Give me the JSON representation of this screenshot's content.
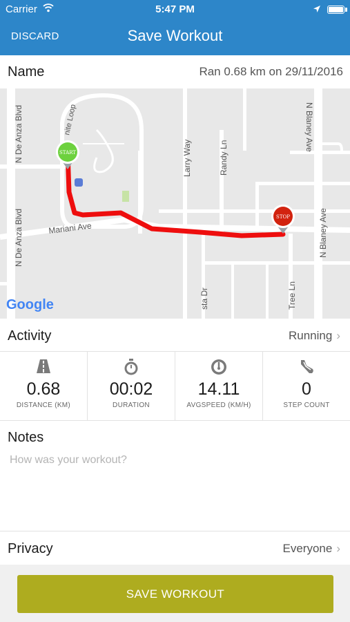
{
  "status_bar": {
    "carrier": "Carrier",
    "time": "5:47 PM"
  },
  "header": {
    "discard_label": "DISCARD",
    "title": "Save Workout",
    "background_color": "#2d86c9"
  },
  "name": {
    "label": "Name",
    "value": "Ran 0.68 km on 29/11/2016"
  },
  "map": {
    "street_labels": [
      "N De Anza Blvd",
      "N De Anza Blvd",
      "nite Loop",
      "Mariani Ave",
      "Larry Way",
      "Randy Ln",
      "N Blaney Ave",
      "N Blaney Ave",
      "sta Dr",
      "Tree Ln"
    ],
    "start_marker": "START",
    "stop_marker": "STOP",
    "logo": "Google",
    "route_color": "#ee0e0e"
  },
  "activity": {
    "label": "Activity",
    "value": "Running"
  },
  "stats": [
    {
      "icon": "road-icon",
      "value": "0.68",
      "label": "DISTANCE (KM)"
    },
    {
      "icon": "stopwatch-icon",
      "value": "00:02",
      "label": "DURATION"
    },
    {
      "icon": "speedometer-icon",
      "value": "14.11",
      "label": "AVGSPEED (KM/H)"
    },
    {
      "icon": "shoe-icon",
      "value": "0",
      "label": "STEP COUNT"
    }
  ],
  "notes": {
    "label": "Notes",
    "placeholder": "How was your workout?"
  },
  "privacy": {
    "label": "Privacy",
    "value": "Everyone"
  },
  "save_button": {
    "label": "SAVE WORKOUT",
    "color": "#aeac1f"
  }
}
